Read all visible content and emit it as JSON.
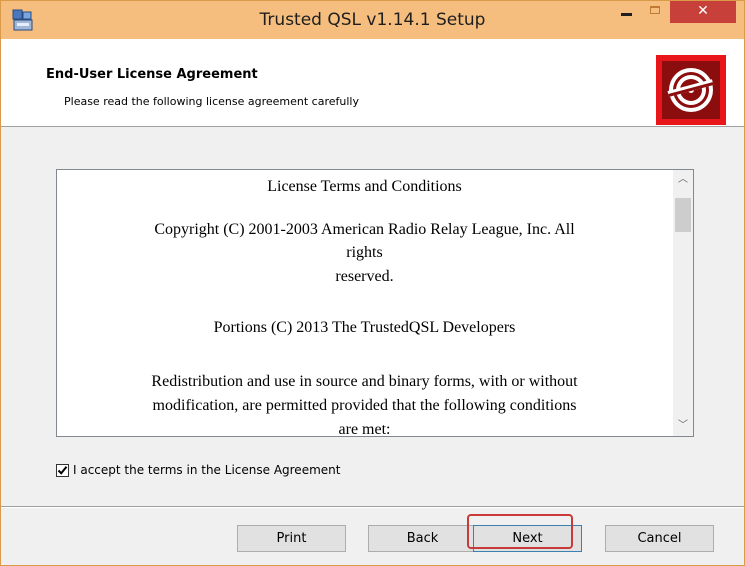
{
  "window": {
    "title": "Trusted QSL v1.14.1 Setup",
    "close_glyph": "✕",
    "accent_color": "#f5be7e",
    "close_color": "#c7403a"
  },
  "banner": {
    "title": "End-User License Agreement",
    "subtitle": "Please read the following license agreement carefully",
    "logo_icon": "disc-logo-icon",
    "logo_color": "#8b0d0d"
  },
  "license": {
    "lines": [
      "License Terms and Conditions",
      "Copyright (C) 2001-2003 American Radio Relay League, Inc. All",
      "rights",
      "reserved.",
      "Portions (C) 2013 The TrustedQSL Developers",
      "Redistribution and use in source and binary forms, with or without",
      "modification, are permitted provided that the following conditions",
      "are met:"
    ],
    "scroll_up_glyph": "︿",
    "scroll_down_glyph": "﹀"
  },
  "accept": {
    "label": "I accept the terms in the License Agreement",
    "checked": true
  },
  "buttons": {
    "print": "Print",
    "back": "Back",
    "next": "Next",
    "cancel": "Cancel"
  }
}
